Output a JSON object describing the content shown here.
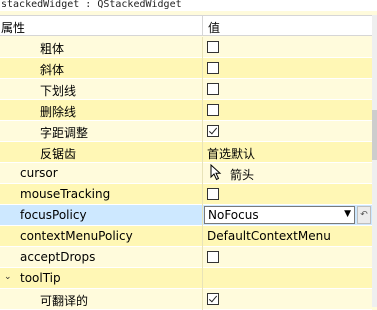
{
  "window": {
    "title": "stackedWidget : QStackedWidget"
  },
  "header": {
    "property": "属性",
    "value": "值"
  },
  "rows": [
    {
      "label": "粗体",
      "checked": false
    },
    {
      "label": "斜体",
      "checked": false
    },
    {
      "label": "下划线",
      "checked": false
    },
    {
      "label": "删除线",
      "checked": false
    },
    {
      "label": "字距调整",
      "checked": true
    },
    {
      "label": "反锯齿",
      "value": "首选默认"
    },
    {
      "label": "cursor",
      "value": "箭头",
      "icon": "arrow-cursor-icon"
    },
    {
      "label": "mouseTracking",
      "checked": false
    },
    {
      "label": "focusPolicy",
      "value": "NoFocus"
    },
    {
      "label": "contextMenuPolicy",
      "value": "DefaultContextMenu"
    },
    {
      "label": "acceptDrops",
      "checked": false
    },
    {
      "label": "toolTip",
      "expanded": true
    },
    {
      "label": "可翻译的",
      "checked": true
    }
  ]
}
